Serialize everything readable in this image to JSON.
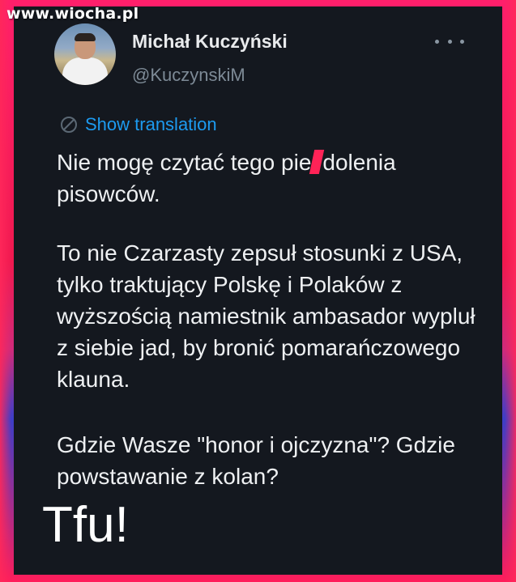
{
  "watermark": "www.wiocha.pl",
  "author": {
    "name": "Michał Kuczyński",
    "handle": "@KuczynskiM"
  },
  "translation": {
    "label": "Show translation"
  },
  "tweet": {
    "p1_before": "Nie mogę czytać tego pie",
    "p1_after": "dolenia pisowców.",
    "p2": "To nie Czarzasty zepsuł stosunki z USA, tylko traktujący Polskę i Polaków z wyższością namiestnik ambasador wypluł z siebie jad, by bronić pomarańczowego klauna.",
    "p3": "Gdzie Wasze \"honor i ojczyzna\"? Gdzie powstawanie z kolan?"
  },
  "caption": "Tfu!",
  "icons": {
    "more": "more-horizontal-icon",
    "translate": "translate-globe-icon"
  },
  "colors": {
    "card_bg": "#14181f",
    "link": "#1d9bf0",
    "accent": "#ff2357"
  }
}
